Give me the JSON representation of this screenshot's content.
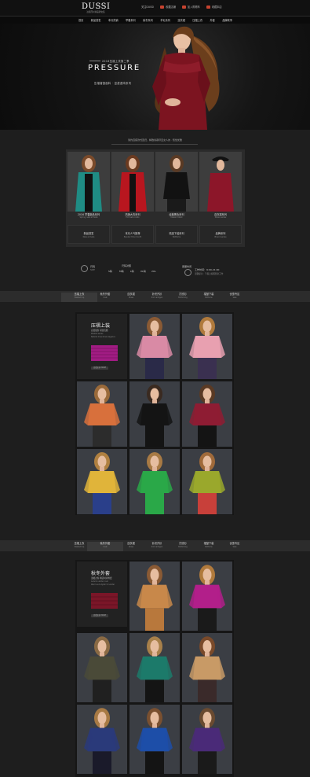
{
  "header": {
    "brand": "DUSSI",
    "tagline": "达斯西时尚品牌女装",
    "links": [
      "关注DUSSI",
      "收藏店铺",
      "加入购物车",
      "收藏本店"
    ],
    "nav": [
      "首页",
      "新品首发",
      "本月热销",
      "早春系列",
      "秋冬系列",
      "羊毛系列",
      "连衣裙",
      "压褶上衣",
      "外套",
      "品牌故事"
    ]
  },
  "hero": {
    "small_line": "2016压褶上衣第二季",
    "title": "PRESSURE",
    "subtitle": "压褶褶皱面料 · 显瘦遮肉系列"
  },
  "intro": {
    "text": "简约百搭款式回归，精致剪裁尽显女人的 · 知性优雅"
  },
  "categories": [
    {
      "label": "2016 早春新品系列",
      "sub": "Spring new arrivals",
      "color": "#1f8c84"
    },
    {
      "label": "热销大衣系列",
      "sub": "Hot sale coats",
      "color": "#b8161f"
    },
    {
      "label": "经典黑色系列",
      "sub": "Classic black",
      "color": "#121212"
    },
    {
      "label": "连衣裙系列",
      "sub": "Dress series",
      "color": "#8c1629"
    }
  ],
  "category_cells": [
    {
      "label": "新品首发",
      "sub": "New arrivals"
    },
    {
      "label": "本月人气推荐",
      "sub": "Popular this month"
    },
    {
      "label": "精选下装系列",
      "sub": "Bottoms"
    },
    {
      "label": "品牌系列",
      "sub": "Brand series"
    }
  ],
  "service": {
    "size_title": "尺码",
    "size_sub": "SIZE",
    "size_head": "尺码对照",
    "sizes": [
      "S码",
      "M码",
      "L码",
      "XL码",
      "2XL"
    ],
    "time_title": "客服时间",
    "time_line": "工作时间：9:00-21:00",
    "time_line2": "温馨提示：节假日客服照常工作"
  },
  "tabs1": {
    "items": [
      {
        "t": "压褶上衣",
        "s": "Pleated top"
      },
      {
        "t": "秋冬外套",
        "s": "Coat"
      },
      {
        "t": "连衣裙",
        "s": "Dress"
      },
      {
        "t": "针织开衫",
        "s": "Knit cardigan"
      },
      {
        "t": "打底衫",
        "s": "Bottoming"
      },
      {
        "t": "褶皱下装",
        "s": "Bottoms"
      },
      {
        "t": "优惠专区",
        "s": "Sale"
      }
    ],
    "active": 0
  },
  "tabs2": {
    "items": [
      {
        "t": "压褶上衣",
        "s": "Pleated top"
      },
      {
        "t": "秋冬外套",
        "s": "Coat"
      },
      {
        "t": "连衣裙",
        "s": "Dress"
      },
      {
        "t": "针织开衫",
        "s": "Knit cardigan"
      },
      {
        "t": "打底衫",
        "s": "Bottoming"
      },
      {
        "t": "褶皱下装",
        "s": "Bottoms"
      },
      {
        "t": "优惠专区",
        "s": "Sale"
      }
    ],
    "active": 1
  },
  "section1": {
    "title": "压褶上装",
    "subtitle": "自然线条 彰显优雅",
    "small1": "Pleated series",
    "small2": "Natural lines show elegance",
    "button": "查看更多 MORE",
    "swatch_color": "#a11c83",
    "products": [
      {
        "top": "#d98aa5",
        "bottom": "#2a2a48",
        "hair": "#8a5a34"
      },
      {
        "top": "#e8a0b0",
        "bottom": "#3a3050",
        "hair": "#b07a3c"
      },
      {
        "top": "#d8703c",
        "bottom": "#2c2c2c",
        "hair": "#9a6a3a"
      },
      {
        "top": "#141414",
        "bottom": "#141414",
        "hair": "#3a2a20"
      },
      {
        "top": "#8e1c33",
        "bottom": "#141414",
        "hair": "#5a3a24"
      },
      {
        "top": "#e0b43a",
        "bottom": "#2a3f8a",
        "hair": "#b08040"
      },
      {
        "top": "#2aa848",
        "bottom": "#2aa848",
        "hair": "#a87a44"
      },
      {
        "top": "#9aa82c",
        "bottom": "#c8403a",
        "hair": "#a06a3a"
      }
    ]
  },
  "section2": {
    "title": "秋冬外套",
    "subtitle": "温暖过冬 精选时尚外套",
    "small1": "Autumn winter coat",
    "small2": "Warm and stylish for winter",
    "button": "查看更多 MORE",
    "swatch_color": "#7a1628",
    "products": [
      {
        "top": "#c8884a",
        "bottom": "#b8783c",
        "hair": "#8a5a34"
      },
      {
        "top": "#b21f8a",
        "bottom": "#1a1a1a",
        "hair": "#b07a3c"
      },
      {
        "top": "#4a4a38",
        "bottom": "#202020",
        "hair": "#8a6a44"
      },
      {
        "top": "#1c7a6a",
        "bottom": "#141414",
        "hair": "#a8804a"
      },
      {
        "top": "#c89a66",
        "bottom": "#3a2a2a",
        "hair": "#7a4a2a"
      },
      {
        "top": "#2a3a7a",
        "bottom": "#1a1a2a",
        "hair": "#a87a44"
      },
      {
        "top": "#1d4ea8",
        "bottom": "#141414",
        "hair": "#7a5030"
      },
      {
        "top": "#4a2a78",
        "bottom": "#1a1a1a",
        "hair": "#6a4a30"
      }
    ]
  }
}
